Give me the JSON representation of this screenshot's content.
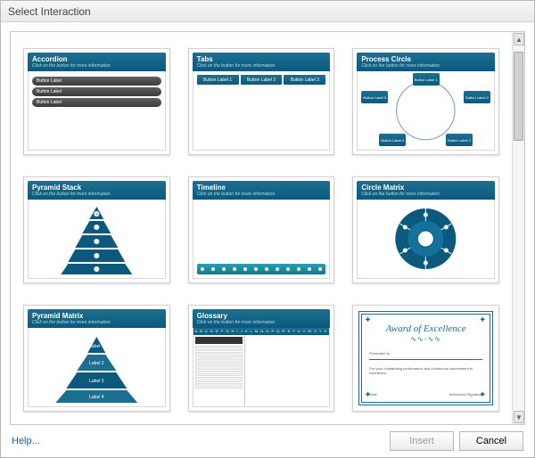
{
  "dialog": {
    "title": "Select Interaction",
    "help": "Help...",
    "insert": "Insert",
    "cancel": "Cancel",
    "insert_enabled": false
  },
  "subtitle": "Click on the button for more information.",
  "items": [
    {
      "key": "accordion",
      "title": "Accordion",
      "rows": [
        "Button Label",
        "Button Label",
        "Button Label"
      ]
    },
    {
      "key": "tabs",
      "title": "Tabs",
      "tabs": [
        "Button Label 1",
        "Button Label 2",
        "Button Label 3"
      ]
    },
    {
      "key": "process-circle",
      "title": "Process Circle",
      "nodes": [
        "Button Label 1",
        "Button Label 2",
        "Button Label 3",
        "Button Label 4",
        "Button Label 5"
      ]
    },
    {
      "key": "pyramid-stack",
      "title": "Pyramid Stack",
      "levels": 5
    },
    {
      "key": "timeline",
      "title": "Timeline",
      "ticks": 12
    },
    {
      "key": "circle-matrix",
      "title": "Circle Matrix",
      "segments": 6
    },
    {
      "key": "pyramid-matrix",
      "title": "Pyramid Matrix",
      "labels": [
        "Label 1",
        "Label 2",
        "Label 3",
        "Label 4"
      ]
    },
    {
      "key": "glossary",
      "title": "Glossary",
      "alpha": "A B C D E F G H I J K L M N O P Q R S T U V W X Y Z",
      "list_count": 7
    },
    {
      "key": "certificate",
      "title": "Award of Excellence",
      "presented": "Presented to",
      "body": "For your outstanding performance and continuous commitment to excellence",
      "date": "Date",
      "sig": "Authorized Signature"
    }
  ]
}
